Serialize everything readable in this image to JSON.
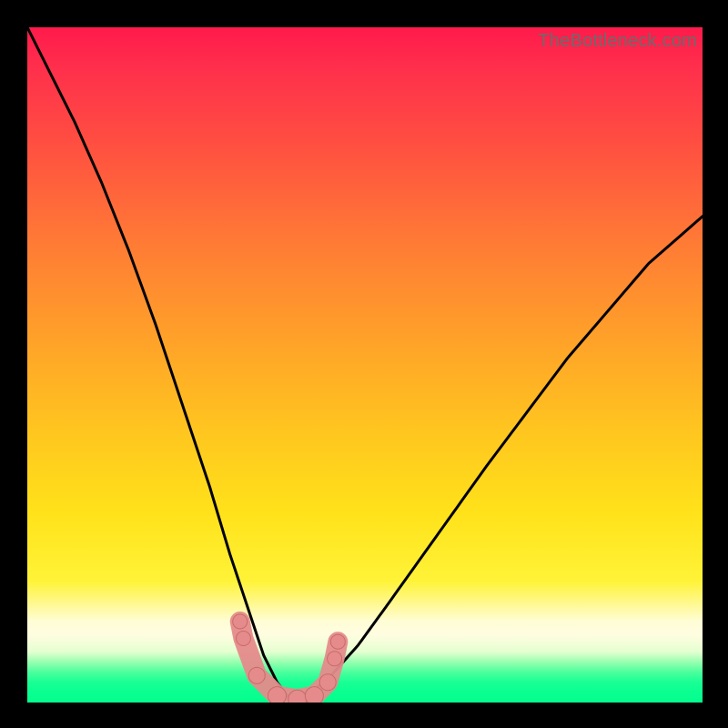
{
  "watermark": {
    "text": "TheBottleneck.com"
  },
  "colors": {
    "bg_black": "#000000",
    "grad_top": "#ff1a4b",
    "grad_mid": "#ffe21a",
    "grad_bottom": "#03ff8e",
    "curve": "#000000",
    "marker_fill": "#e58b8b",
    "marker_stroke": "#c96a6a"
  },
  "chart_data": {
    "type": "line",
    "title": "",
    "xlabel": "",
    "ylabel": "",
    "xlim": [
      0,
      100
    ],
    "ylim": [
      0,
      100
    ],
    "notes": "V-shaped bottleneck curve over a vertical heat gradient. Y encodes bottleneck severity (0 = none/green at bottom, 100 = severe/red at top). The minimum (~0) is reached near x≈38. The left branch descends steeply from the top-left corner; the right branch rises with decreasing slope toward the right edge reaching ~72 at x=100. Pink markers sit along the trough near the minimum.",
    "series": [
      {
        "name": "left-branch",
        "x": [
          0,
          3,
          7,
          11,
          15,
          19,
          23,
          27,
          30,
          33,
          35,
          37,
          38.5,
          40
        ],
        "y": [
          100,
          94,
          86,
          77,
          67,
          56,
          44,
          32,
          22,
          13,
          7,
          3,
          1,
          0
        ]
      },
      {
        "name": "right-branch",
        "x": [
          40,
          42,
          45,
          49,
          53,
          58,
          63,
          68,
          74,
          80,
          86,
          92,
          100
        ],
        "y": [
          0,
          1.5,
          4,
          8.5,
          14,
          21,
          28,
          35,
          43,
          51,
          58,
          65,
          72
        ]
      }
    ],
    "markers": {
      "name": "trough-points",
      "x": [
        31.5,
        32,
        34,
        37,
        40,
        42.5,
        44.5,
        45.5,
        46
      ],
      "y": [
        12,
        9.5,
        4,
        1,
        0.5,
        1,
        3,
        6.5,
        9
      ],
      "r": [
        8,
        8,
        9,
        10,
        10,
        10,
        9,
        8,
        8
      ]
    }
  }
}
